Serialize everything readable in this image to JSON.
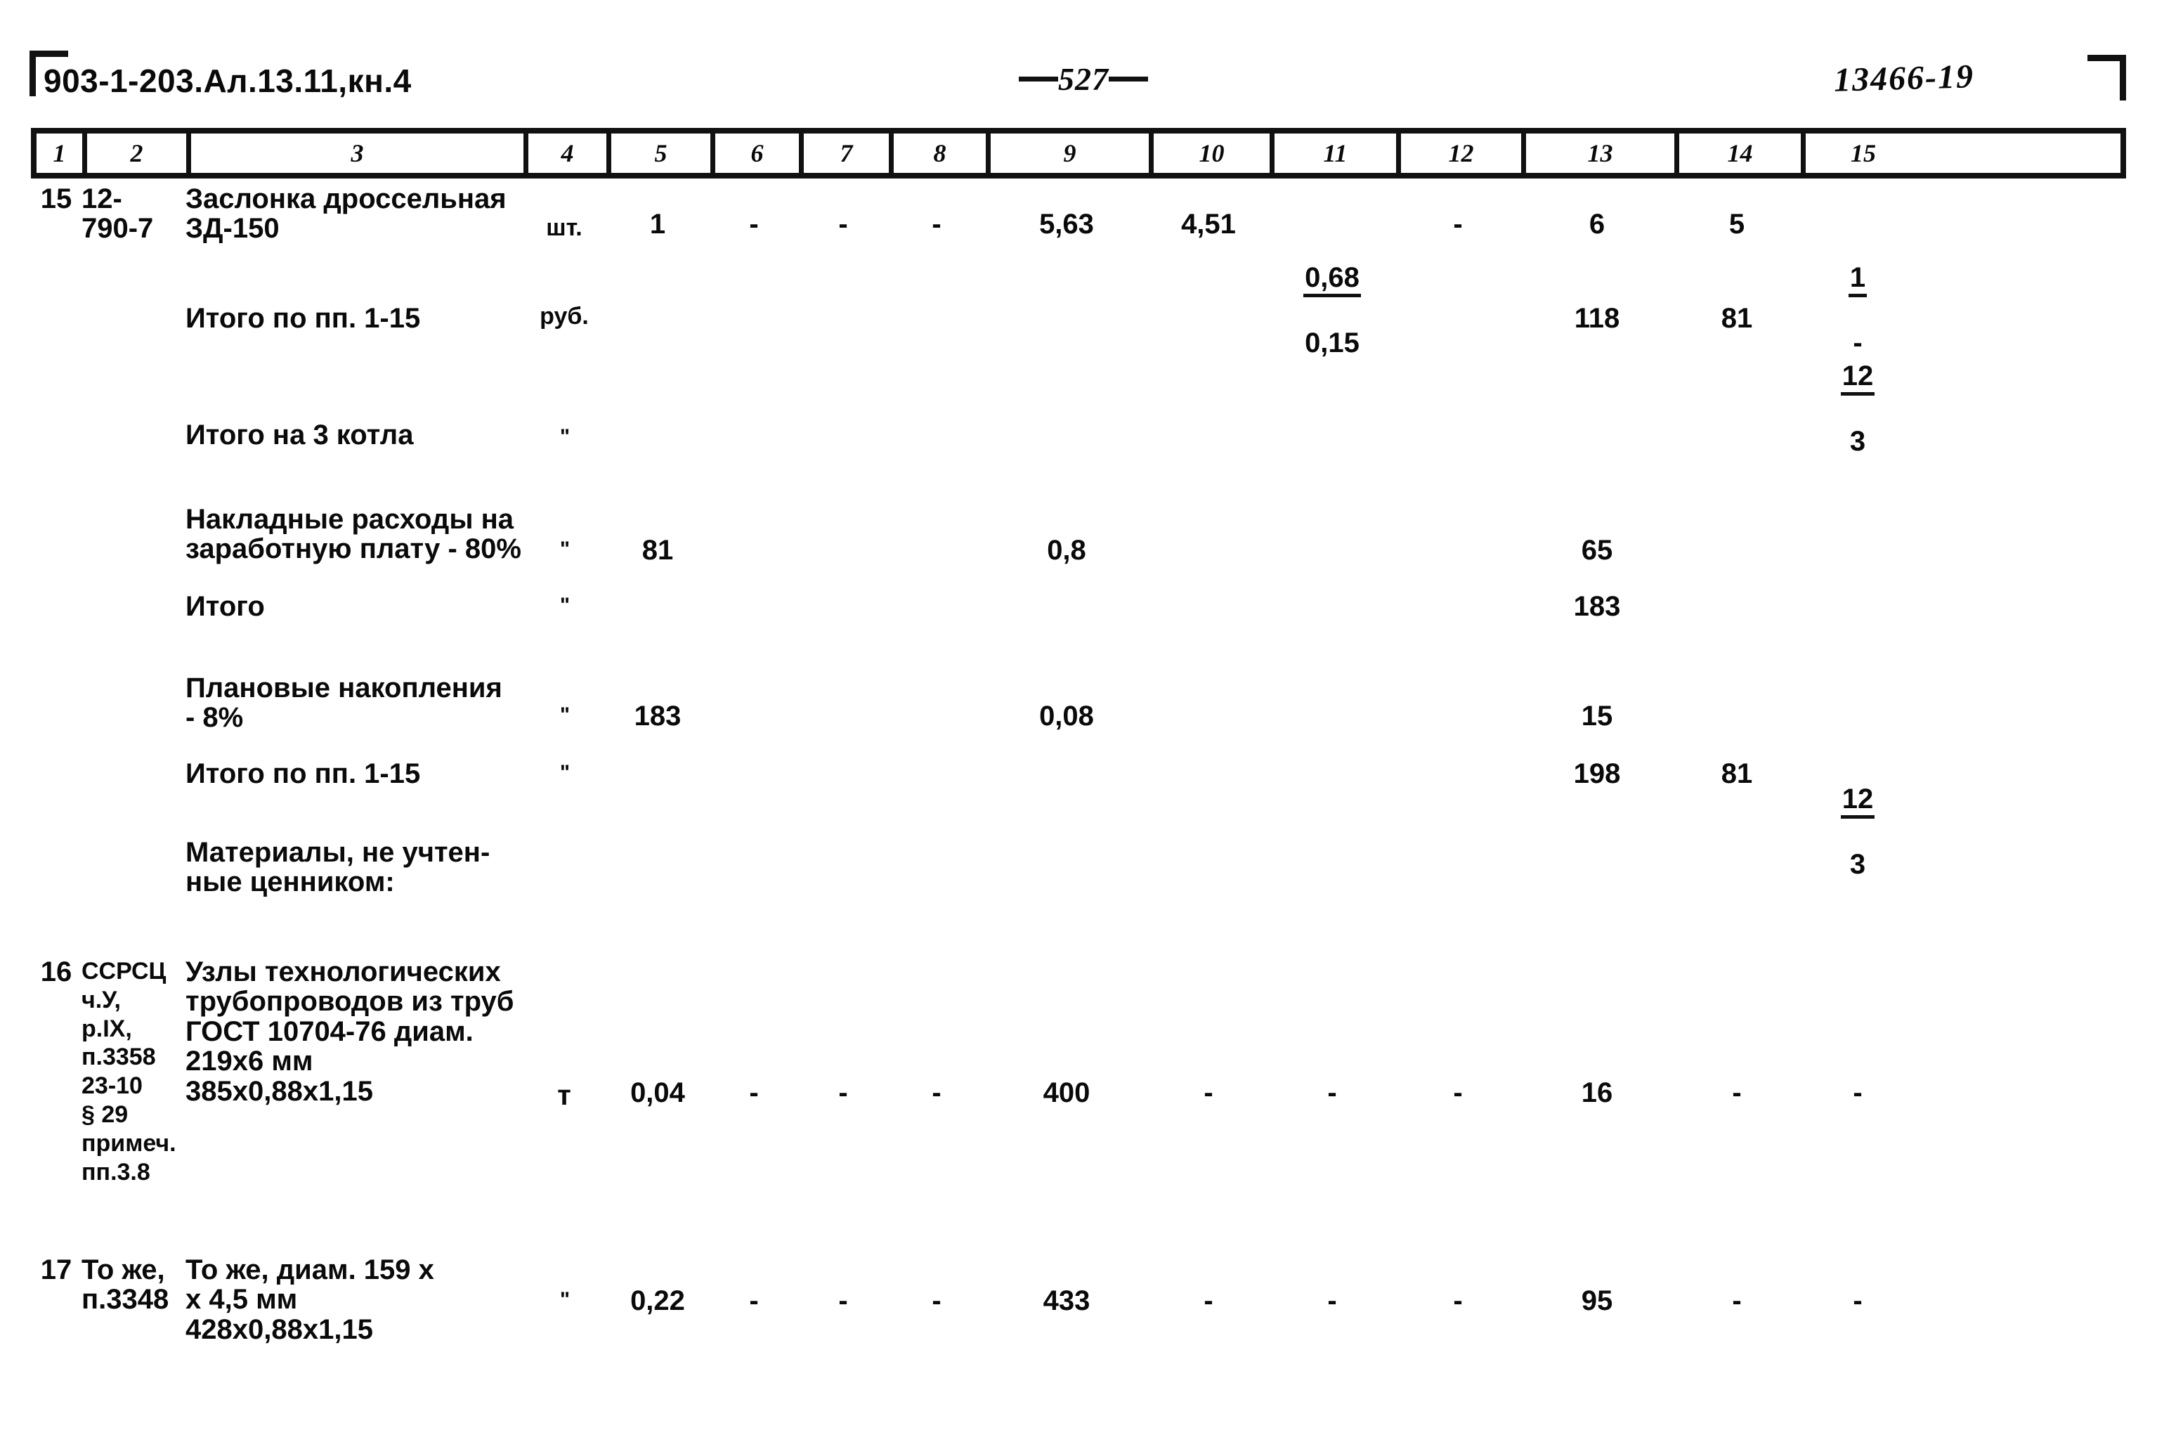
{
  "header": {
    "left_code": "903-1-203.Ал.13.11,кн.4",
    "page_number": "527",
    "right_stamp": "13466-19"
  },
  "table": {
    "column_numbers": [
      "1",
      "2",
      "3",
      "4",
      "5",
      "6",
      "7",
      "8",
      "9",
      "10",
      "11",
      "12",
      "13",
      "14",
      "15"
    ],
    "rows": [
      {
        "kind": "item",
        "col1": "15",
        "col2": "12-\n790-7",
        "col3": "Заслонка дроссельная\nЗД-150",
        "col4": "шт.",
        "col5": "1",
        "col6": "-",
        "col7": "-",
        "col8": "-",
        "col9": "5,63",
        "col10": "4,51",
        "col11_top": "0,68",
        "col11_bot": "0,15",
        "col12": "-",
        "col13": "6",
        "col14": "5",
        "col15_top": "1",
        "col15_bot": "-"
      },
      {
        "kind": "total",
        "col3": "Итого по пп. 1-15",
        "col4": "руб.",
        "col13": "118",
        "col14": "81",
        "col15_top": "12",
        "col15_bot": "3"
      },
      {
        "kind": "total",
        "col3": "Итого на 3 котла",
        "col4": "\""
      },
      {
        "kind": "total",
        "col3": "Накладные расходы на\nзаработную плату - 80%",
        "col4": "\"",
        "col5": "81",
        "col9": "0,8",
        "col13": "65"
      },
      {
        "kind": "total",
        "col3": "Итого",
        "col4": "\"",
        "col13": "183"
      },
      {
        "kind": "total",
        "col3": "Плановые накопления\n- 8%",
        "col4": "\"",
        "col5": "183",
        "col9": "0,08",
        "col13": "15"
      },
      {
        "kind": "total",
        "col3": "Итого по пп. 1-15",
        "col4": "\"",
        "col13": "198",
        "col14": "81",
        "col15_top": "12",
        "col15_bot": "3"
      },
      {
        "kind": "caption",
        "col3": "Материалы, не учтен-\nные ценником:"
      },
      {
        "kind": "item",
        "col1": "16",
        "col2": "ССРСЦ\nч.У,\nр.IX,\nп.3358\n23-10\n§ 29\nпримеч.\nпп.3.8",
        "col3": "Узлы технологических\nтрубопроводов из труб\nГОСТ 10704-76 диам.\n219x6 мм\n385x0,88x1,15",
        "col4": "т",
        "col5": "0,04",
        "col6": "-",
        "col7": "-",
        "col8": "-",
        "col9": "400",
        "col10": "-",
        "col11": "-",
        "col12": "-",
        "col13": "16",
        "col14": "-",
        "col15": "-"
      },
      {
        "kind": "item",
        "col1": "17",
        "col2": "То же,\nп.3348",
        "col3": "То же, диам. 159 х\nх 4,5 мм\n428х0,88х1,15",
        "col4": "\"",
        "col5": "0,22",
        "col6": "-",
        "col7": "-",
        "col8": "-",
        "col9": "433",
        "col10": "-",
        "col11": "-",
        "col12": "-",
        "col13": "95",
        "col14": "-",
        "col15": "-"
      }
    ]
  }
}
